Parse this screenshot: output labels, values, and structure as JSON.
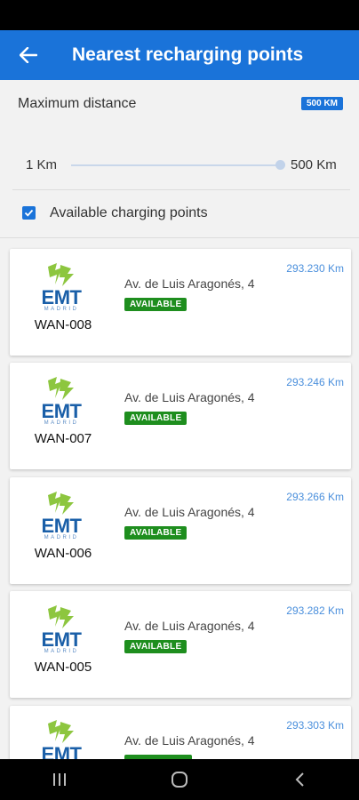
{
  "header": {
    "title": "Nearest recharging points",
    "back_icon": "arrow-left-icon"
  },
  "filters": {
    "max_distance_label": "Maximum distance",
    "max_distance_badge": "500 KM",
    "range_min": "1 Km",
    "range_max": "500 Km",
    "slider_value_km": 500,
    "available_label": "Available charging points",
    "available_checked": true
  },
  "points": [
    {
      "code": "WAN-008",
      "address": "Av. de Luis Aragonés, 4",
      "status": "AVAILABLE",
      "distance": "293.230 Km"
    },
    {
      "code": "WAN-007",
      "address": "Av. de Luis Aragonés, 4",
      "status": "AVAILABLE",
      "distance": "293.246 Km"
    },
    {
      "code": "WAN-006",
      "address": "Av. de Luis Aragonés, 4",
      "status": "AVAILABLE",
      "distance": "293.266 Km"
    },
    {
      "code": "WAN-005",
      "address": "Av. de Luis Aragonés, 4",
      "status": "AVAILABLE",
      "distance": "293.282 Km"
    },
    {
      "code": "",
      "address": "Av. de Luis Aragonés, 4",
      "status": "",
      "distance": "293.303 Km"
    }
  ],
  "logo": {
    "text": "EMT",
    "subtext": "MADRID"
  },
  "colors": {
    "primary": "#1a73d9",
    "available": "#1e8e1e",
    "bolt": "#8dc63f",
    "logo_blue": "#1a5fa8"
  },
  "nav": {
    "recents_icon": "recents-icon",
    "home_icon": "home-icon",
    "back_icon": "back-chevron-icon"
  }
}
